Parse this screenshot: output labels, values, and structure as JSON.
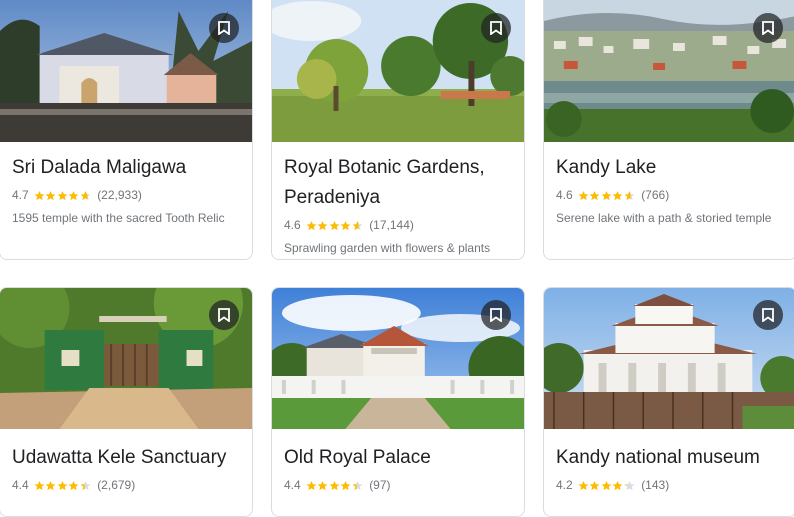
{
  "colors": {
    "star_filled": "#fbbc04",
    "star_empty": "#dadce0",
    "text_primary": "#202124",
    "text_secondary": "#70757a"
  },
  "places": [
    {
      "title": "Sri Dalada Maligawa",
      "rating": "4.7",
      "stars": 4.7,
      "reviews": "(22,933)",
      "description": "1595 temple with the sacred Tooth Relic",
      "save_icon": "bookmark-icon"
    },
    {
      "title": "Royal Botanic Gardens, Peradeniya",
      "title_line1": "Royal Botanic Gardens,",
      "title_line2": "Peradeniya",
      "rating": "4.6",
      "stars": 4.6,
      "reviews": "(17,144)",
      "description": "Sprawling garden with flowers & plants",
      "save_icon": "bookmark-icon"
    },
    {
      "title": "Kandy Lake",
      "rating": "4.6",
      "stars": 4.6,
      "reviews": "(766)",
      "description": "Serene lake with a path & storied temple",
      "save_icon": "bookmark-icon"
    },
    {
      "title": "Udawatta Kele Sanctuary",
      "rating": "4.4",
      "stars": 4.4,
      "reviews": "(2,679)",
      "description": "",
      "save_icon": "bookmark-icon"
    },
    {
      "title": "Old Royal Palace",
      "rating": "4.4",
      "stars": 4.4,
      "reviews": "(97)",
      "description": "",
      "save_icon": "bookmark-icon"
    },
    {
      "title": "Kandy national museum",
      "rating": "4.2",
      "stars": 4.2,
      "reviews": "(143)",
      "description": "",
      "save_icon": "bookmark-icon"
    }
  ]
}
